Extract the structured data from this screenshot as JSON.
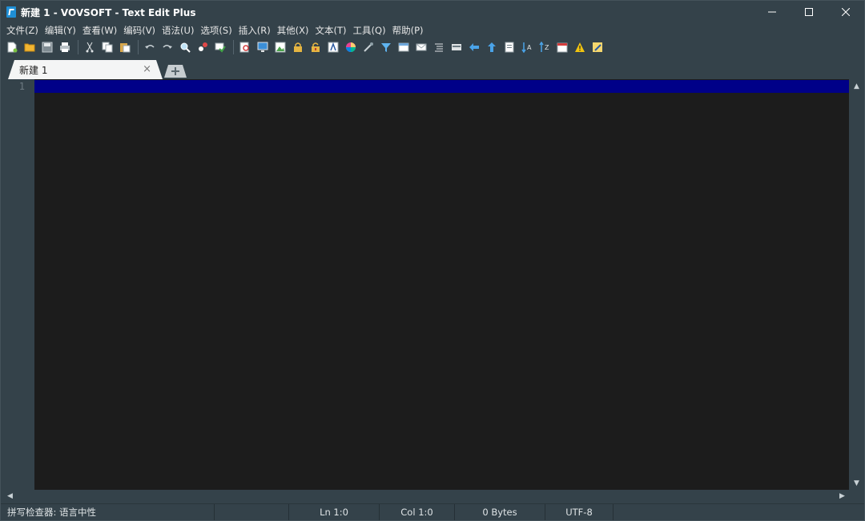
{
  "window": {
    "title": "新建 1 - VOVSOFT - Text Edit Plus"
  },
  "menu": {
    "items": [
      {
        "label": "文件(Z)"
      },
      {
        "label": "编辑(Y)"
      },
      {
        "label": "查看(W)"
      },
      {
        "label": "编码(V)"
      },
      {
        "label": "语法(U)"
      },
      {
        "label": "选项(S)"
      },
      {
        "label": "插入(R)"
      },
      {
        "label": "其他(X)"
      },
      {
        "label": "文本(T)"
      },
      {
        "label": "工具(Q)"
      },
      {
        "label": "帮助(P)"
      }
    ]
  },
  "toolbar": {
    "groups": [
      [
        "new-file-icon",
        "open-folder-icon",
        "save-icon",
        "print-icon"
      ],
      [
        "cut-icon",
        "copy-icon",
        "paste-icon"
      ],
      [
        "undo-icon",
        "redo-icon",
        "find-icon",
        "replace-icon",
        "spell-check-icon"
      ],
      [
        "find-in-files-icon",
        "monitor-icon",
        "image-icon",
        "lock-icon",
        "unlock-icon",
        "font-icon",
        "color-picker-icon",
        "eyedropper-icon",
        "filter-icon",
        "table-icon",
        "mail-icon",
        "list-icon",
        "form-icon",
        "back-arrow-icon",
        "up-arrow-icon",
        "document-icon",
        "sort-az-icon",
        "sort-za-icon",
        "calendar-icon",
        "warning-icon",
        "edit-icon"
      ]
    ]
  },
  "tabs": {
    "active_label": "新建 1",
    "close_symbol": "×"
  },
  "editor": {
    "line_numbers": [
      "1"
    ],
    "current_line_color": "#000088",
    "background_color": "#1c1c1c"
  },
  "status": {
    "spell_check": "拼写检查器: 语言中性",
    "line": "Ln 1:0",
    "column": "Col 1:0",
    "size": "0 Bytes",
    "encoding": "UTF-8"
  }
}
